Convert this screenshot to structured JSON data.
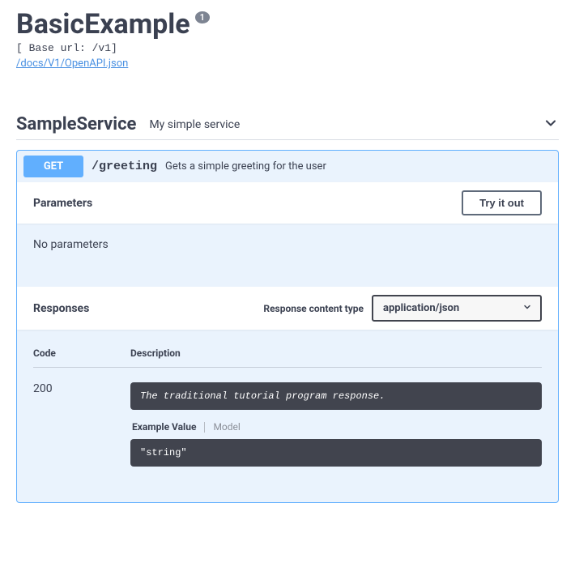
{
  "header": {
    "title": "BasicExample",
    "version": "1",
    "base_url_line": "[ Base url: /v1]",
    "spec_link": "/docs/V1/OpenAPI.json"
  },
  "tag": {
    "name": "SampleService",
    "description": "My simple service"
  },
  "operation": {
    "method": "GET",
    "path": "/greeting",
    "summary": "Gets a simple greeting for the user",
    "parameters_header": "Parameters",
    "try_button": "Try it out",
    "no_params": "No parameters",
    "responses_header": "Responses",
    "content_type_label": "Response content type",
    "content_type_value": "application/json",
    "table": {
      "col_code": "Code",
      "col_desc": "Description"
    },
    "response": {
      "code": "200",
      "description": "The traditional tutorial program response.",
      "tabs": {
        "example": "Example Value",
        "model": "Model"
      },
      "example_body": "\"string\""
    }
  }
}
